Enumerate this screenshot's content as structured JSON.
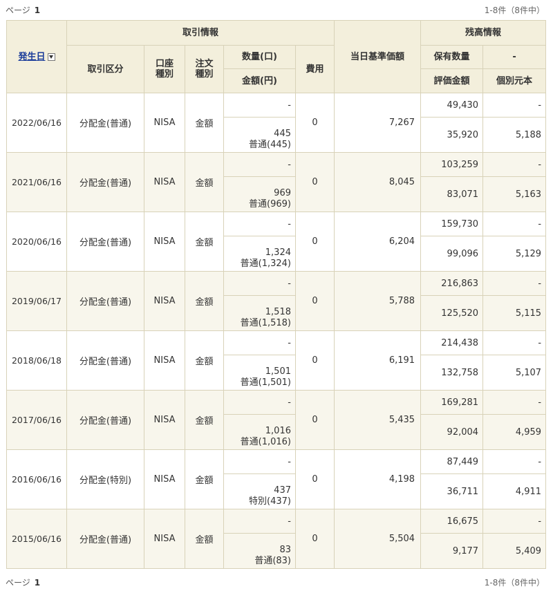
{
  "pager": {
    "page_label": "ページ",
    "page_number": "1",
    "count_text": "1-8件（8件中）"
  },
  "headers": {
    "date": "発生日",
    "trade_info": "取引情報",
    "balance_info": "残高情報",
    "trade_type": "取引区分",
    "account_type": "口座種別",
    "order_type": "注文種別",
    "quantity": "数量(口)",
    "amount": "金額(円)",
    "fee": "費用",
    "base_price": "当日基準価額",
    "holdings": "保有数量",
    "dash": "-",
    "valuation": "評価金額",
    "principal": "個別元本"
  },
  "rows": [
    {
      "date": "2022/06/16",
      "type": "分配金(普通)",
      "account": "NISA",
      "order": "金額",
      "qty": "-",
      "amount": "445",
      "amount_detail": "普通(445)",
      "fee": "0",
      "base_price": "7,267",
      "holdings": "49,430",
      "holdings_dash": "-",
      "valuation": "35,920",
      "principal": "5,188"
    },
    {
      "date": "2021/06/16",
      "type": "分配金(普通)",
      "account": "NISA",
      "order": "金額",
      "qty": "-",
      "amount": "969",
      "amount_detail": "普通(969)",
      "fee": "0",
      "base_price": "8,045",
      "holdings": "103,259",
      "holdings_dash": "-",
      "valuation": "83,071",
      "principal": "5,163"
    },
    {
      "date": "2020/06/16",
      "type": "分配金(普通)",
      "account": "NISA",
      "order": "金額",
      "qty": "-",
      "amount": "1,324",
      "amount_detail": "普通(1,324)",
      "fee": "0",
      "base_price": "6,204",
      "holdings": "159,730",
      "holdings_dash": "-",
      "valuation": "99,096",
      "principal": "5,129"
    },
    {
      "date": "2019/06/17",
      "type": "分配金(普通)",
      "account": "NISA",
      "order": "金額",
      "qty": "-",
      "amount": "1,518",
      "amount_detail": "普通(1,518)",
      "fee": "0",
      "base_price": "5,788",
      "holdings": "216,863",
      "holdings_dash": "-",
      "valuation": "125,520",
      "principal": "5,115"
    },
    {
      "date": "2018/06/18",
      "type": "分配金(普通)",
      "account": "NISA",
      "order": "金額",
      "qty": "-",
      "amount": "1,501",
      "amount_detail": "普通(1,501)",
      "fee": "0",
      "base_price": "6,191",
      "holdings": "214,438",
      "holdings_dash": "-",
      "valuation": "132,758",
      "principal": "5,107"
    },
    {
      "date": "2017/06/16",
      "type": "分配金(普通)",
      "account": "NISA",
      "order": "金額",
      "qty": "-",
      "amount": "1,016",
      "amount_detail": "普通(1,016)",
      "fee": "0",
      "base_price": "5,435",
      "holdings": "169,281",
      "holdings_dash": "-",
      "valuation": "92,004",
      "principal": "4,959"
    },
    {
      "date": "2016/06/16",
      "type": "分配金(特別)",
      "account": "NISA",
      "order": "金額",
      "qty": "-",
      "amount": "437",
      "amount_detail": "特別(437)",
      "fee": "0",
      "base_price": "4,198",
      "holdings": "87,449",
      "holdings_dash": "-",
      "valuation": "36,711",
      "principal": "4,911"
    },
    {
      "date": "2015/06/16",
      "type": "分配金(普通)",
      "account": "NISA",
      "order": "金額",
      "qty": "-",
      "amount": "83",
      "amount_detail": "普通(83)",
      "fee": "0",
      "base_price": "5,504",
      "holdings": "16,675",
      "holdings_dash": "-",
      "valuation": "9,177",
      "principal": "5,409"
    }
  ]
}
